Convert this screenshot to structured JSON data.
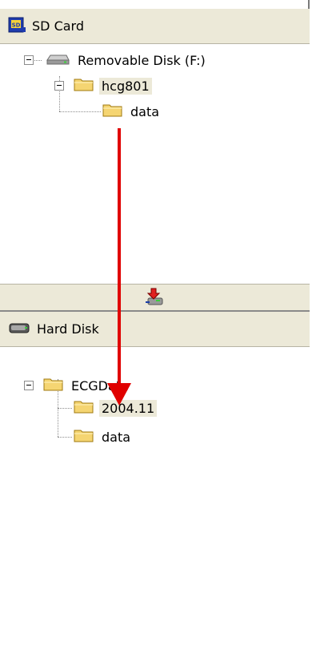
{
  "sd_card": {
    "title": "SD Card",
    "icon": "sd-card-icon",
    "tree": {
      "drive_label": "Removable Disk (F:)",
      "folder_label": "hcg801",
      "subfolder_label": "data"
    }
  },
  "toolbar": {
    "transfer_icon": "transfer-icon"
  },
  "hard_disk": {
    "title": "Hard Disk",
    "icon": "hard-disk-icon",
    "tree": {
      "root_label": "ECGData",
      "child1_label": "2004.11",
      "child2_label": "data"
    }
  },
  "colors": {
    "arrow": "#e00000",
    "header_bg": "#ece9d8",
    "selection_bg": "#ece9d8",
    "folder": "#f5d572"
  }
}
